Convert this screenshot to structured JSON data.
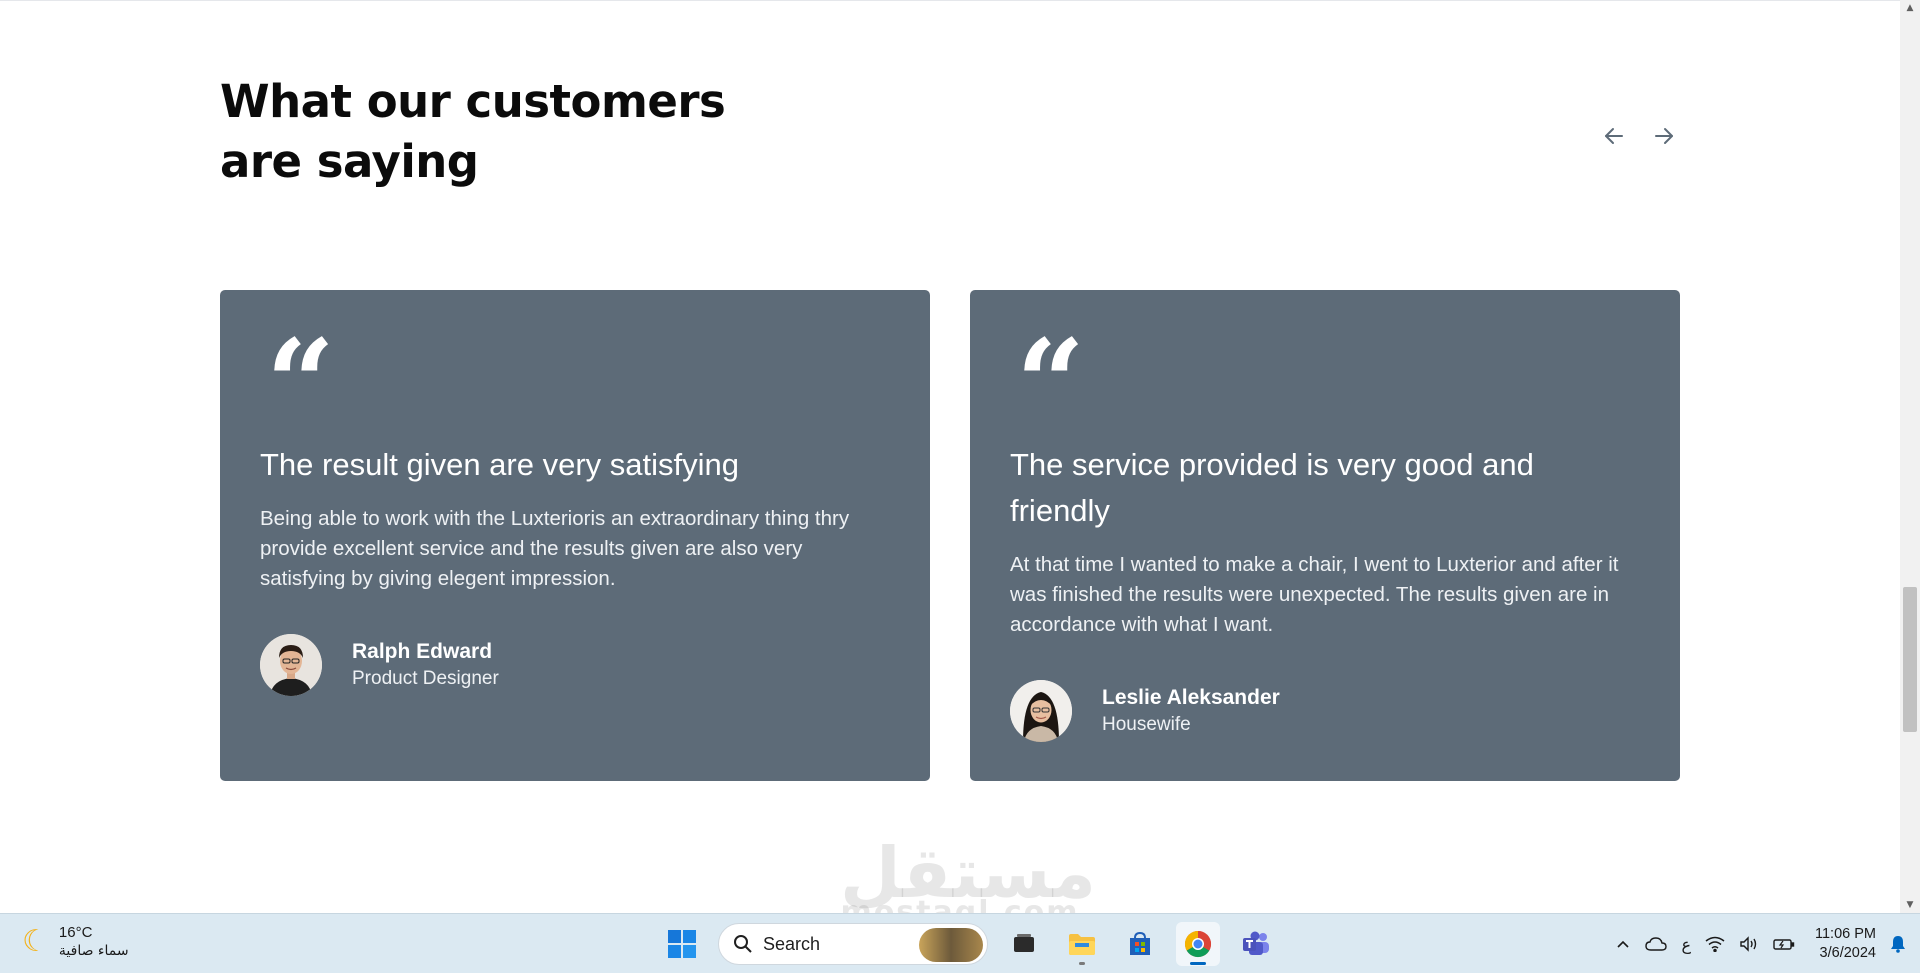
{
  "section": {
    "title_line1": "What our customers",
    "title_line2": "are saying"
  },
  "testimonials": [
    {
      "quote_mark": "“",
      "heading": "The result given are very satisfying",
      "text": "Being able to work with the Luxterioris an extraordinary thing thry provide excellent service and the results given are also very satisfying by giving elegent impression.",
      "author": "Ralph Edward",
      "role": "Product Designer"
    },
    {
      "quote_mark": "“",
      "heading": "The service provided is very good and friendly",
      "text": "At that time I wanted to make a chair, I went to Luxterior and after it was finished the results were unexpected. The results given are in accordance with what I want.",
      "author": "Leslie Aleksander",
      "role": "Housewife"
    }
  ],
  "watermark": {
    "arabic": "مستقل",
    "latin": "mostaql.com"
  },
  "taskbar": {
    "weather_temp": "16°C",
    "weather_desc": "سماء صافية",
    "search_label": "Search",
    "keyboard_lang": "ع",
    "time": "11:06 PM",
    "date": "3/6/2024"
  },
  "colors": {
    "card_bg": "#5d6b78",
    "heading": "#0b0b0b",
    "arrow": "#5d6b78",
    "taskbar_bg": "#dbe9f2"
  }
}
